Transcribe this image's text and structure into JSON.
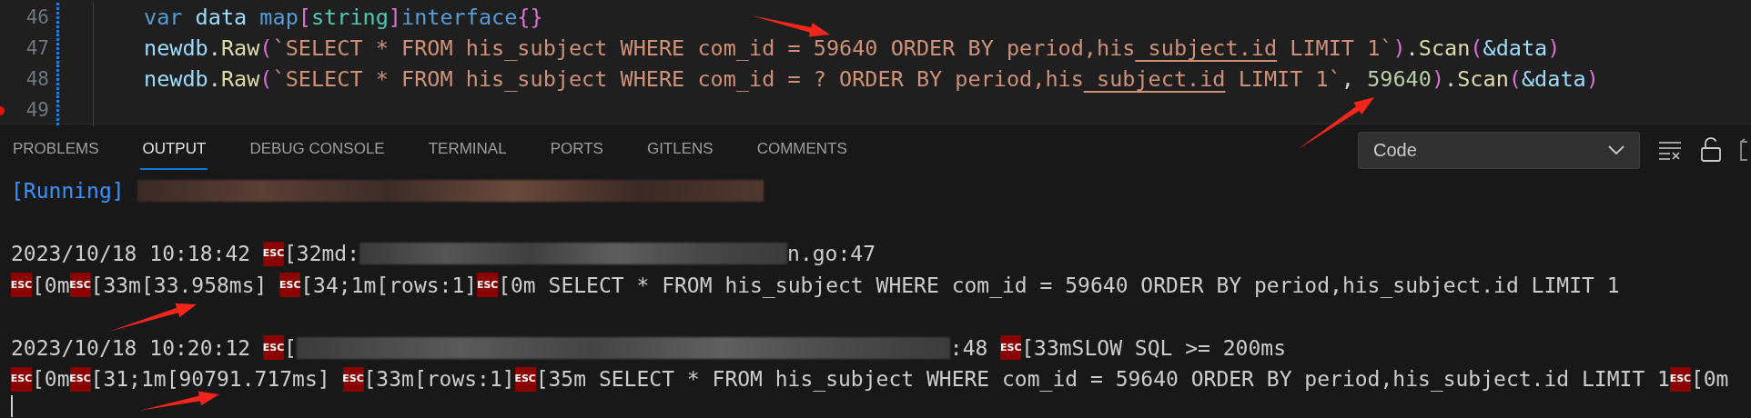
{
  "editor": {
    "lines": [
      {
        "number": "46",
        "breakpoint": false,
        "tokens": [
          {
            "text": "var",
            "kind": "keyword"
          },
          {
            "text": " data",
            "kind": "variable"
          },
          {
            "text": " map",
            "kind": "keyword"
          },
          {
            "text": "[",
            "kind": "bracket"
          },
          {
            "text": "string",
            "kind": "type"
          },
          {
            "text": "]",
            "kind": "bracket"
          },
          {
            "text": "interface",
            "kind": "keyword"
          },
          {
            "text": "{}",
            "kind": "bracket"
          }
        ]
      },
      {
        "number": "47",
        "breakpoint": false,
        "tokens": [
          {
            "text": "newdb",
            "kind": "variable"
          },
          {
            "text": ".",
            "kind": "plain"
          },
          {
            "text": "Raw",
            "kind": "function"
          },
          {
            "text": "(",
            "kind": "bracket"
          },
          {
            "text": "`SELECT * FROM his_subject WHERE com_id = 59640 ORDER BY period,his",
            "kind": "string"
          },
          {
            "text": "_subject.id",
            "kind": "string-flagged"
          },
          {
            "text": " LIMIT 1`",
            "kind": "string"
          },
          {
            "text": ")",
            "kind": "bracket"
          },
          {
            "text": ".",
            "kind": "plain"
          },
          {
            "text": "Scan",
            "kind": "function"
          },
          {
            "text": "(",
            "kind": "bracket"
          },
          {
            "text": "&data",
            "kind": "variable"
          },
          {
            "text": ")",
            "kind": "bracket"
          }
        ]
      },
      {
        "number": "48",
        "breakpoint": false,
        "tokens": [
          {
            "text": "newdb",
            "kind": "variable"
          },
          {
            "text": ".",
            "kind": "plain"
          },
          {
            "text": "Raw",
            "kind": "function"
          },
          {
            "text": "(",
            "kind": "bracket"
          },
          {
            "text": "`SELECT * FROM his_subject WHERE com_id = ? ORDER BY period,his",
            "kind": "string"
          },
          {
            "text": "_subject.id",
            "kind": "string-flagged"
          },
          {
            "text": " LIMIT 1`",
            "kind": "string"
          },
          {
            "text": ", ",
            "kind": "plain"
          },
          {
            "text": "59640",
            "kind": "number"
          },
          {
            "text": ")",
            "kind": "bracket"
          },
          {
            "text": ".",
            "kind": "plain"
          },
          {
            "text": "Scan",
            "kind": "function"
          },
          {
            "text": "(",
            "kind": "bracket"
          },
          {
            "text": "&data",
            "kind": "variable"
          },
          {
            "text": ")",
            "kind": "bracket"
          }
        ]
      },
      {
        "number": "49",
        "breakpoint": true
      }
    ]
  },
  "panel": {
    "tabs": [
      {
        "label": "PROBLEMS",
        "selected": false
      },
      {
        "label": "OUTPUT",
        "selected": true
      },
      {
        "label": "DEBUG CONSOLE",
        "selected": false
      },
      {
        "label": "TERMINAL",
        "selected": false
      },
      {
        "label": "PORTS",
        "selected": false
      },
      {
        "label": "GITLENS",
        "selected": false
      },
      {
        "label": "COMMENTS",
        "selected": false
      }
    ],
    "channel_select": {
      "value": "Code"
    },
    "output": [
      {
        "kind": "text",
        "segments": [
          {
            "kind": "status",
            "text": "[Running]"
          },
          {
            "kind": "redacted"
          }
        ]
      },
      {
        "kind": "blank"
      },
      {
        "kind": "text",
        "segments": [
          {
            "kind": "text",
            "text": "2023/10/18 10:18:42 "
          },
          {
            "kind": "esc",
            "text": "ESC"
          },
          {
            "kind": "text",
            "text": "[32md:"
          },
          {
            "kind": "redacted"
          },
          {
            "kind": "text",
            "text": "n.go:47"
          }
        ]
      },
      {
        "kind": "text",
        "segments": [
          {
            "kind": "esc",
            "text": "ESC"
          },
          {
            "kind": "text",
            "text": "[0m"
          },
          {
            "kind": "esc",
            "text": "ESC"
          },
          {
            "kind": "text",
            "text": "[33m[33.958ms] "
          },
          {
            "kind": "esc",
            "text": "ESC"
          },
          {
            "kind": "text",
            "text": "[34;1m[rows:1]"
          },
          {
            "kind": "esc",
            "text": "ESC"
          },
          {
            "kind": "text",
            "text": "[0m SELECT * FROM his_subject WHERE com_id = 59640 ORDER BY period,his_subject.id LIMIT 1"
          }
        ]
      },
      {
        "kind": "blank"
      },
      {
        "kind": "text",
        "segments": [
          {
            "kind": "text",
            "text": "2023/10/18 10:20:12 "
          },
          {
            "kind": "esc",
            "text": "ESC"
          },
          {
            "kind": "text",
            "text": "["
          },
          {
            "kind": "redacted"
          },
          {
            "kind": "text",
            "text": ":48 "
          },
          {
            "kind": "esc",
            "text": "ESC"
          },
          {
            "kind": "text",
            "text": "[33mSLOW SQL >= 200ms"
          }
        ]
      },
      {
        "kind": "text",
        "segments": [
          {
            "kind": "esc",
            "text": "ESC"
          },
          {
            "kind": "text",
            "text": "[0m"
          },
          {
            "kind": "esc",
            "text": "ESC"
          },
          {
            "kind": "text",
            "text": "[31;1m[90791.717ms] "
          },
          {
            "kind": "esc",
            "text": "ESC"
          },
          {
            "kind": "text",
            "text": "[33m[rows:1]"
          },
          {
            "kind": "esc",
            "text": "ESC"
          },
          {
            "kind": "text",
            "text": "[35m SELECT * FROM his_subject WHERE com_id = 59640 ORDER BY period,his_subject.id LIMIT 1"
          },
          {
            "kind": "esc",
            "text": "ESC"
          },
          {
            "kind": "text",
            "text": "[0m"
          }
        ]
      }
    ]
  }
}
